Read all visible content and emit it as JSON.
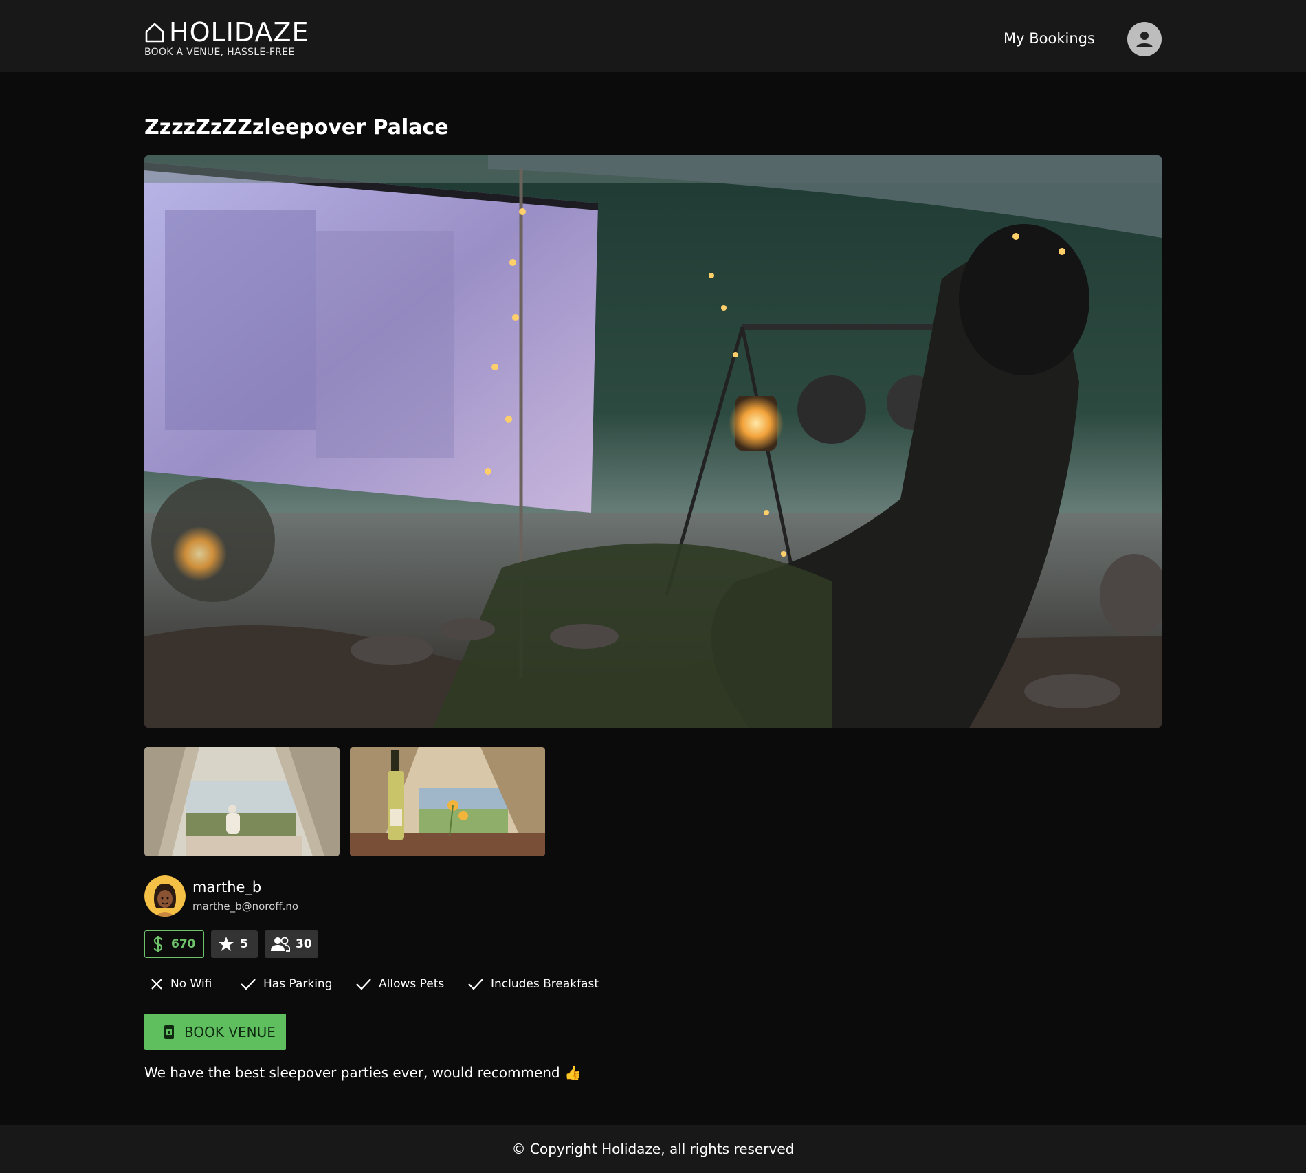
{
  "header": {
    "brand_name": "HOLIDAZE",
    "tagline": "BOOK A VENUE, HASSLE-FREE",
    "nav_bookings": "My Bookings",
    "logo_icon": "house-outline-icon",
    "profile_icon": "account-circle-icon"
  },
  "venue": {
    "title": "ZzzzZzZZzleepover Palace",
    "hero_image_icon": "outdoor-cinema-campsite-photo",
    "thumbnails": [
      {
        "icon": "tent-lake-picnic-photo"
      },
      {
        "icon": "tent-wine-flowers-photo"
      }
    ],
    "owner": {
      "name": "marthe_b",
      "email": "marthe_b@noroff.no"
    },
    "stats": {
      "price": "670",
      "rating": "5",
      "max_guests": "30"
    },
    "amenities": [
      {
        "label": "No Wifi",
        "icon": "close-icon"
      },
      {
        "label": "Has Parking",
        "icon": "check-icon"
      },
      {
        "label": "Allows Pets",
        "icon": "check-icon"
      },
      {
        "label": "Includes Breakfast",
        "icon": "check-icon"
      }
    ],
    "book_label": "BOOK VENUE",
    "description": "We have the best sleepover parties ever, would recommend 👍"
  },
  "footer": {
    "copyright": "© Copyright Holidaze, all rights reserved"
  },
  "colors": {
    "page_bg": "#0b0b0b",
    "bar_bg": "#181818",
    "accent_green": "#5fbf5f",
    "chip_bg": "#333333"
  }
}
